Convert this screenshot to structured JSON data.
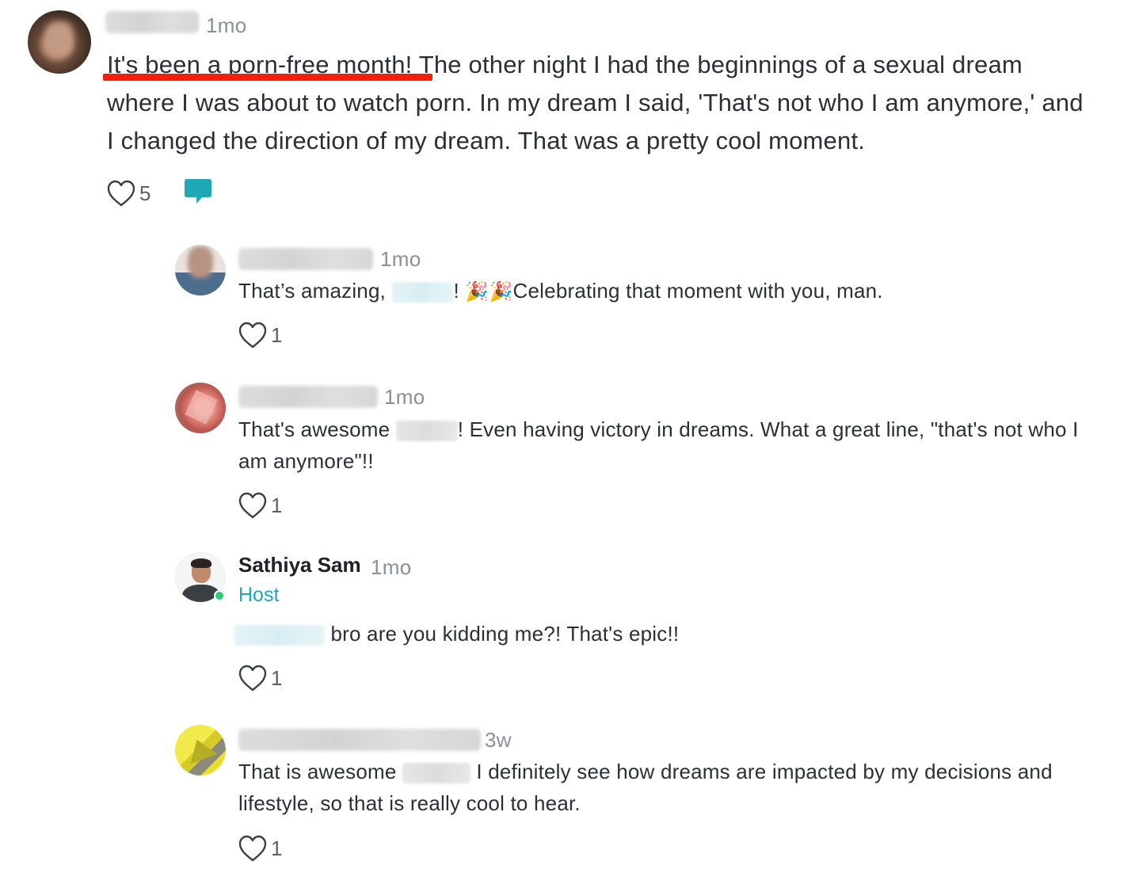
{
  "post": {
    "time": "1mo",
    "highlight": "It's been a porn-free month!",
    "body": " The other night I had the beginnings of a sexual dream where I was about to watch porn. In my dream I said, 'That's not who I am anymore,' and I changed the direction of my dream. That was a pretty cool moment.",
    "likes": "5"
  },
  "replies": [
    {
      "time": "1mo",
      "text_before": "That’s amazing,",
      "text_after": "Celebrating that moment with you, man.",
      "punct": "!",
      "emoji": "🎉🎉",
      "likes": "1"
    },
    {
      "time": "1mo",
      "text_before": "That's awesome",
      "text_after": "! Even having victory in dreams. What a great line, \"that's not who I am anymore\"!!",
      "likes": "1"
    },
    {
      "name": "Sathiya Sam",
      "time": "1mo",
      "badge": "Host",
      "text_after": "bro are you kidding me?! That's epic!!",
      "likes": "1"
    },
    {
      "time": "3w",
      "text_before": "That is awesome",
      "text_after": " I definitely see how dreams are impacted by my decisions and lifestyle, so that is really cool to hear.",
      "likes": "1"
    }
  ],
  "icons": {
    "like": "heart-outline-icon",
    "comment": "speech-bubble-icon"
  },
  "colors": {
    "accent": "#1fa7b6",
    "highlight_underline": "#f0220e",
    "online": "#2ecc71"
  }
}
